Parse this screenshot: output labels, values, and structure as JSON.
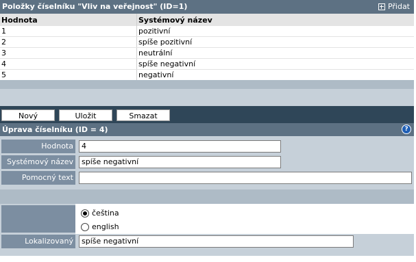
{
  "items_panel": {
    "title": "Položky číselníku \"Vliv na veřejnost\" (ID=1)",
    "add_label": "Přidat",
    "columns": [
      "Hodnota",
      "Systémový název"
    ],
    "rows": [
      {
        "value": "1",
        "name": "pozitivní"
      },
      {
        "value": "2",
        "name": "spíše pozitivní"
      },
      {
        "value": "3",
        "name": "neutrální"
      },
      {
        "value": "4",
        "name": "spíše negativní"
      },
      {
        "value": "5",
        "name": "negativní"
      }
    ]
  },
  "buttons": {
    "new": "Nový",
    "save": "Uložit",
    "delete": "Smazat"
  },
  "edit_panel": {
    "title": "Úprava číselníku (ID = 4)",
    "help": "?",
    "fields": {
      "value_label": "Hodnota",
      "value": "4",
      "system_name_label": "Systémový název",
      "system_name": "spíše negativní",
      "helper_text_label": "Pomocný text",
      "helper_text": ""
    },
    "languages": [
      {
        "label": "čeština",
        "selected": true
      },
      {
        "label": "english",
        "selected": false
      }
    ],
    "localized_label": "Lokalizovaný název",
    "localized_value": "spíše negativní"
  },
  "colors": {
    "header_bar": "#5d7183",
    "button_bar": "#2f4658",
    "label_bg": "#7c8ea1",
    "panel_bg": "#c6d0d9"
  }
}
